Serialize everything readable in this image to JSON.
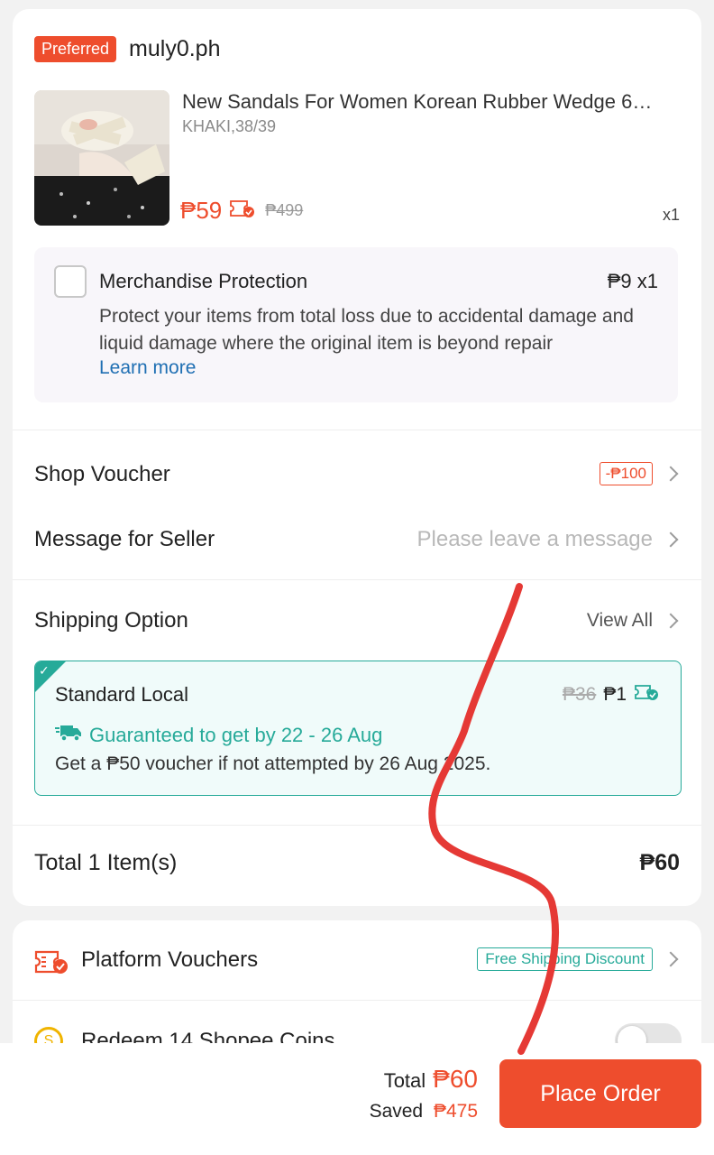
{
  "shop": {
    "badge": "Preferred",
    "name": "muly0.ph"
  },
  "product": {
    "title": "New Sandals For Women Korean Rubber Wedge 6…",
    "variant": "KHAKI,38/39",
    "price": "₱59",
    "original_price": "₱499",
    "quantity": "x1",
    "image_icon": "sandals-product-photo"
  },
  "protection": {
    "title": "Merchandise Protection",
    "price": "₱9  x1",
    "description": "Protect your items from total loss due to accidental damage and liquid damage where the original item is beyond repair",
    "link": "Learn more",
    "checked": false
  },
  "shop_voucher": {
    "label": "Shop Voucher",
    "value": "-₱100"
  },
  "message": {
    "label": "Message for Seller",
    "placeholder": "Please leave a message"
  },
  "shipping": {
    "label": "Shipping Option",
    "view_all": "View All",
    "option_title": "Standard Local",
    "old_price": "₱36",
    "price": "₱1",
    "guarantee": "Guaranteed to get by 22 - 26 Aug",
    "note": "Get a ₱50 voucher if not attempted by 26 Aug 2025."
  },
  "total_items": {
    "label": "Total 1 Item(s)",
    "value": "₱60"
  },
  "platform_vouchers": {
    "label": "Platform Vouchers",
    "chip": "Free Shipping Discount"
  },
  "coins": {
    "label": "Redeem 14 Shopee Coins",
    "enabled": false
  },
  "bottom": {
    "total_label": "Total",
    "total_value": "₱60",
    "saved_label": "Saved",
    "saved_value": "₱475",
    "place_order": "Place Order"
  },
  "colors": {
    "accent": "#ee4d2d",
    "teal": "#26aa99",
    "link": "#1f6fb3"
  }
}
